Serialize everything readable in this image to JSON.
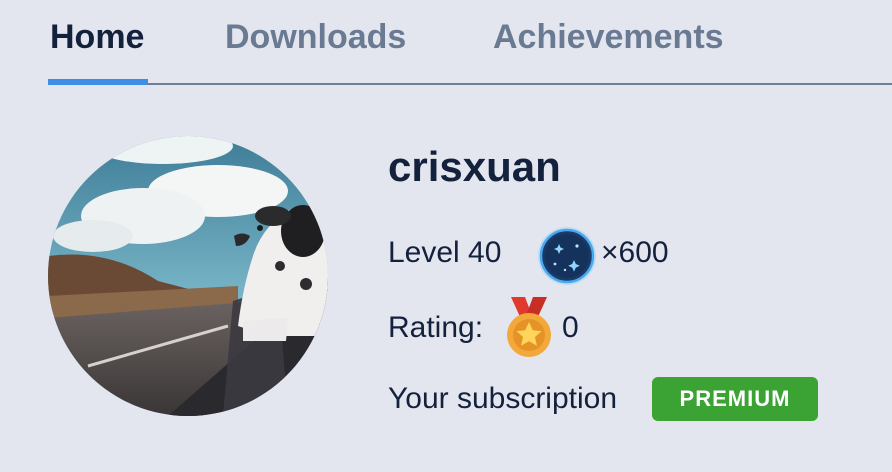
{
  "tabs": [
    {
      "label": "Home",
      "active": true
    },
    {
      "label": "Downloads",
      "active": false
    },
    {
      "label": "Achievements",
      "active": false
    }
  ],
  "profile": {
    "username": "crisxuan",
    "level_label": "Level 40",
    "coins": "×600",
    "rating_label": "Rating:",
    "rating_value": "0",
    "subscription_label": "Your subscription",
    "subscription_badge": "PREMIUM"
  },
  "colors": {
    "background": "#e3e6ee",
    "accent": "#3e8ee8",
    "text": "#14213d",
    "inactive_tab": "#6b7a93",
    "premium": "#3ba234"
  },
  "icons": {
    "coin": "galaxy-coin-icon",
    "medal": "star-medal-icon"
  }
}
